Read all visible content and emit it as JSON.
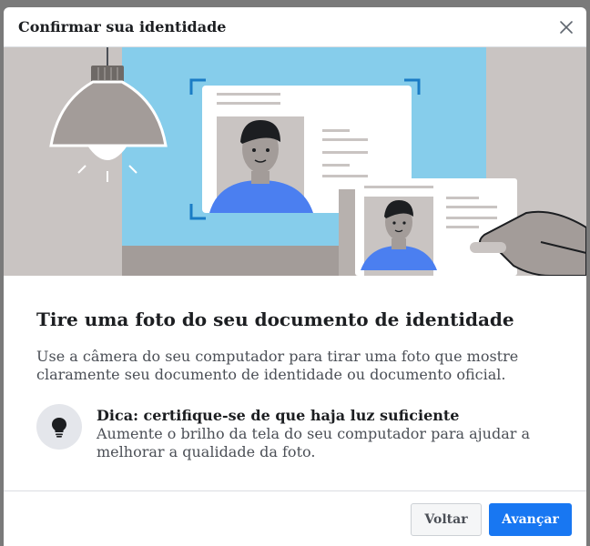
{
  "dialog": {
    "title": "Confirmar sua identidade",
    "close_icon": "close-icon"
  },
  "illustration": {
    "icon": "id-document-illustration",
    "colors": {
      "sky": "#86cdeb",
      "wall": "#c9c4c2",
      "lamp": "#a39c99",
      "shirt": "#4b7ff0",
      "skin": "#a39c99",
      "hair": "#1c1e21"
    }
  },
  "main": {
    "heading": "Tire uma foto do seu documento de identidade",
    "description": "Use a câmera do seu computador para tirar uma foto que mostre claramente seu documento de identidade ou documento oficial."
  },
  "tip": {
    "icon": "lightbulb-icon",
    "title": "Dica: certifique-se de que haja luz suficiente",
    "body": "Aumente o brilho da tela do seu computador para ajudar a melhorar a qualidade da foto."
  },
  "footer": {
    "back_label": "Voltar",
    "next_label": "Avançar",
    "primary_color": "#1877f2"
  }
}
